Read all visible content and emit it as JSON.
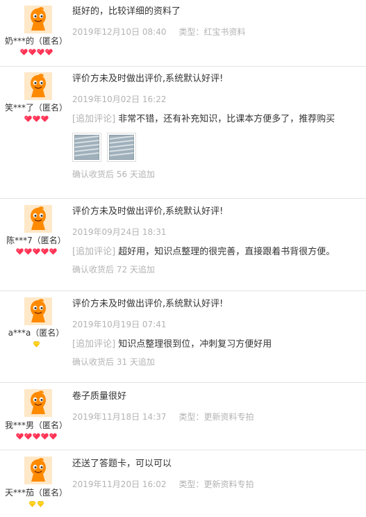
{
  "reviews": [
    {
      "user": "奶***的（匿名）",
      "level": "4-red",
      "comment": "挺好的，比较详细的资料了",
      "date": "2019年12月10日 08:40",
      "category_label": "类型：",
      "category": "红宝书资料"
    },
    {
      "user": "笑***了（匿名）",
      "level": "3-red",
      "comment": "评价方未及时做出评价,系统默认好评!",
      "date": "2019年10月02日 16:22",
      "followup_tag": "[追加评论]",
      "followup": "非常不错，还有补充知识，比课本方便多了，推荐购买",
      "image_count": 2,
      "followup_time": "确认收货后 56 天追加"
    },
    {
      "user": "陈***7（匿名）",
      "level": "5-red",
      "comment": "评价方未及时做出评价,系统默认好评!",
      "date": "2019年09月24日 18:31",
      "followup_tag": "[追加评论]",
      "followup": "超好用，知识点整理的很完善，直接跟着书背很方便。",
      "followup_time": "确认收货后 72 天追加"
    },
    {
      "user": "a***a（匿名）",
      "level": "1-yellow",
      "comment": "评价方未及时做出评价,系统默认好评!",
      "date": "2019年10月19日 07:41",
      "followup_tag": "[追加评论]",
      "followup": "知识点整理很到位，冲刺复习方便好用",
      "followup_time": "确认收货后 31 天追加"
    },
    {
      "user": "我***男（匿名）",
      "level": "5-red",
      "comment": "卷子质量很好",
      "date": "2019年11月18日 14:37",
      "category_label": "类型：",
      "category": "更新资料专拍"
    },
    {
      "user": "天***茄（匿名）",
      "level": "2-yellow",
      "comment": "还送了答题卡，可以可以",
      "date": "2019年11月20日 16:02",
      "category_label": "类型：",
      "category": "更新资料专拍"
    }
  ],
  "colors": {
    "heart": "#ff3355",
    "diamond": "#ffcc00",
    "avatar": "#ff8a00",
    "meta": "#b3b3b3"
  },
  "icons": {
    "avatar": "orange-mascot-avatar-icon",
    "red_level": "red-heart-icon",
    "yellow_level": "yellow-diamond-icon",
    "thumbnail": "review-photo-thumbnail"
  }
}
